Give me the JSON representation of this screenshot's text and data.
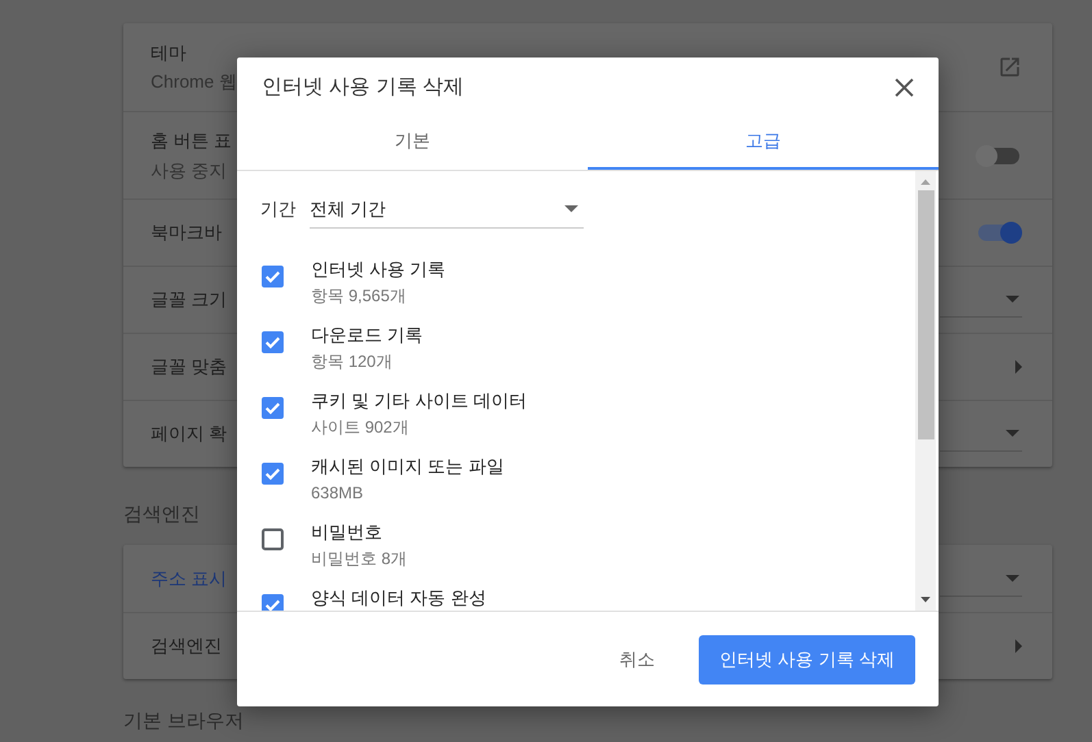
{
  "settings": {
    "cards": [
      {
        "rows": [
          {
            "kind": "link",
            "label": "테마",
            "detail": "Chrome 웹"
          },
          {
            "kind": "toggle",
            "label": "홈 버튼 표",
            "detail": "사용 중지",
            "on": false
          },
          {
            "kind": "toggle",
            "label": "북마크바",
            "on": true
          },
          {
            "kind": "select",
            "label": "글꼴 크기"
          },
          {
            "kind": "submenu",
            "label": "글꼴 맞춤"
          },
          {
            "kind": "select",
            "label": "페이지 확"
          }
        ]
      },
      {
        "heading": "검색엔진",
        "rows": [
          {
            "kind": "select",
            "label": "주소 표시",
            "link": true
          },
          {
            "kind": "submenu",
            "label": "검색엔진"
          }
        ]
      }
    ],
    "footer_heading": "기본 브라우저"
  },
  "dialog": {
    "title": "인터넷 사용 기록 삭제",
    "tabs": [
      {
        "label": "기본",
        "selected": false
      },
      {
        "label": "고급",
        "selected": true
      }
    ],
    "period": {
      "label": "기간",
      "value": "전체 기간"
    },
    "items": [
      {
        "label": "인터넷 사용 기록",
        "detail": "항목 9,565개",
        "checked": true
      },
      {
        "label": "다운로드 기록",
        "detail": "항목 120개",
        "checked": true
      },
      {
        "label": "쿠키 및 기타 사이트 데이터",
        "detail": "사이트 902개",
        "checked": true
      },
      {
        "label": "캐시된 이미지 또는 파일",
        "detail": "638MB",
        "checked": true
      },
      {
        "label": "비밀번호",
        "detail": "비밀번호 8개",
        "checked": false
      },
      {
        "label": "양식 데이터 자동 완성",
        "checked": true
      }
    ],
    "buttons": {
      "cancel": "취소",
      "confirm": "인터넷 사용 기록 삭제"
    }
  }
}
